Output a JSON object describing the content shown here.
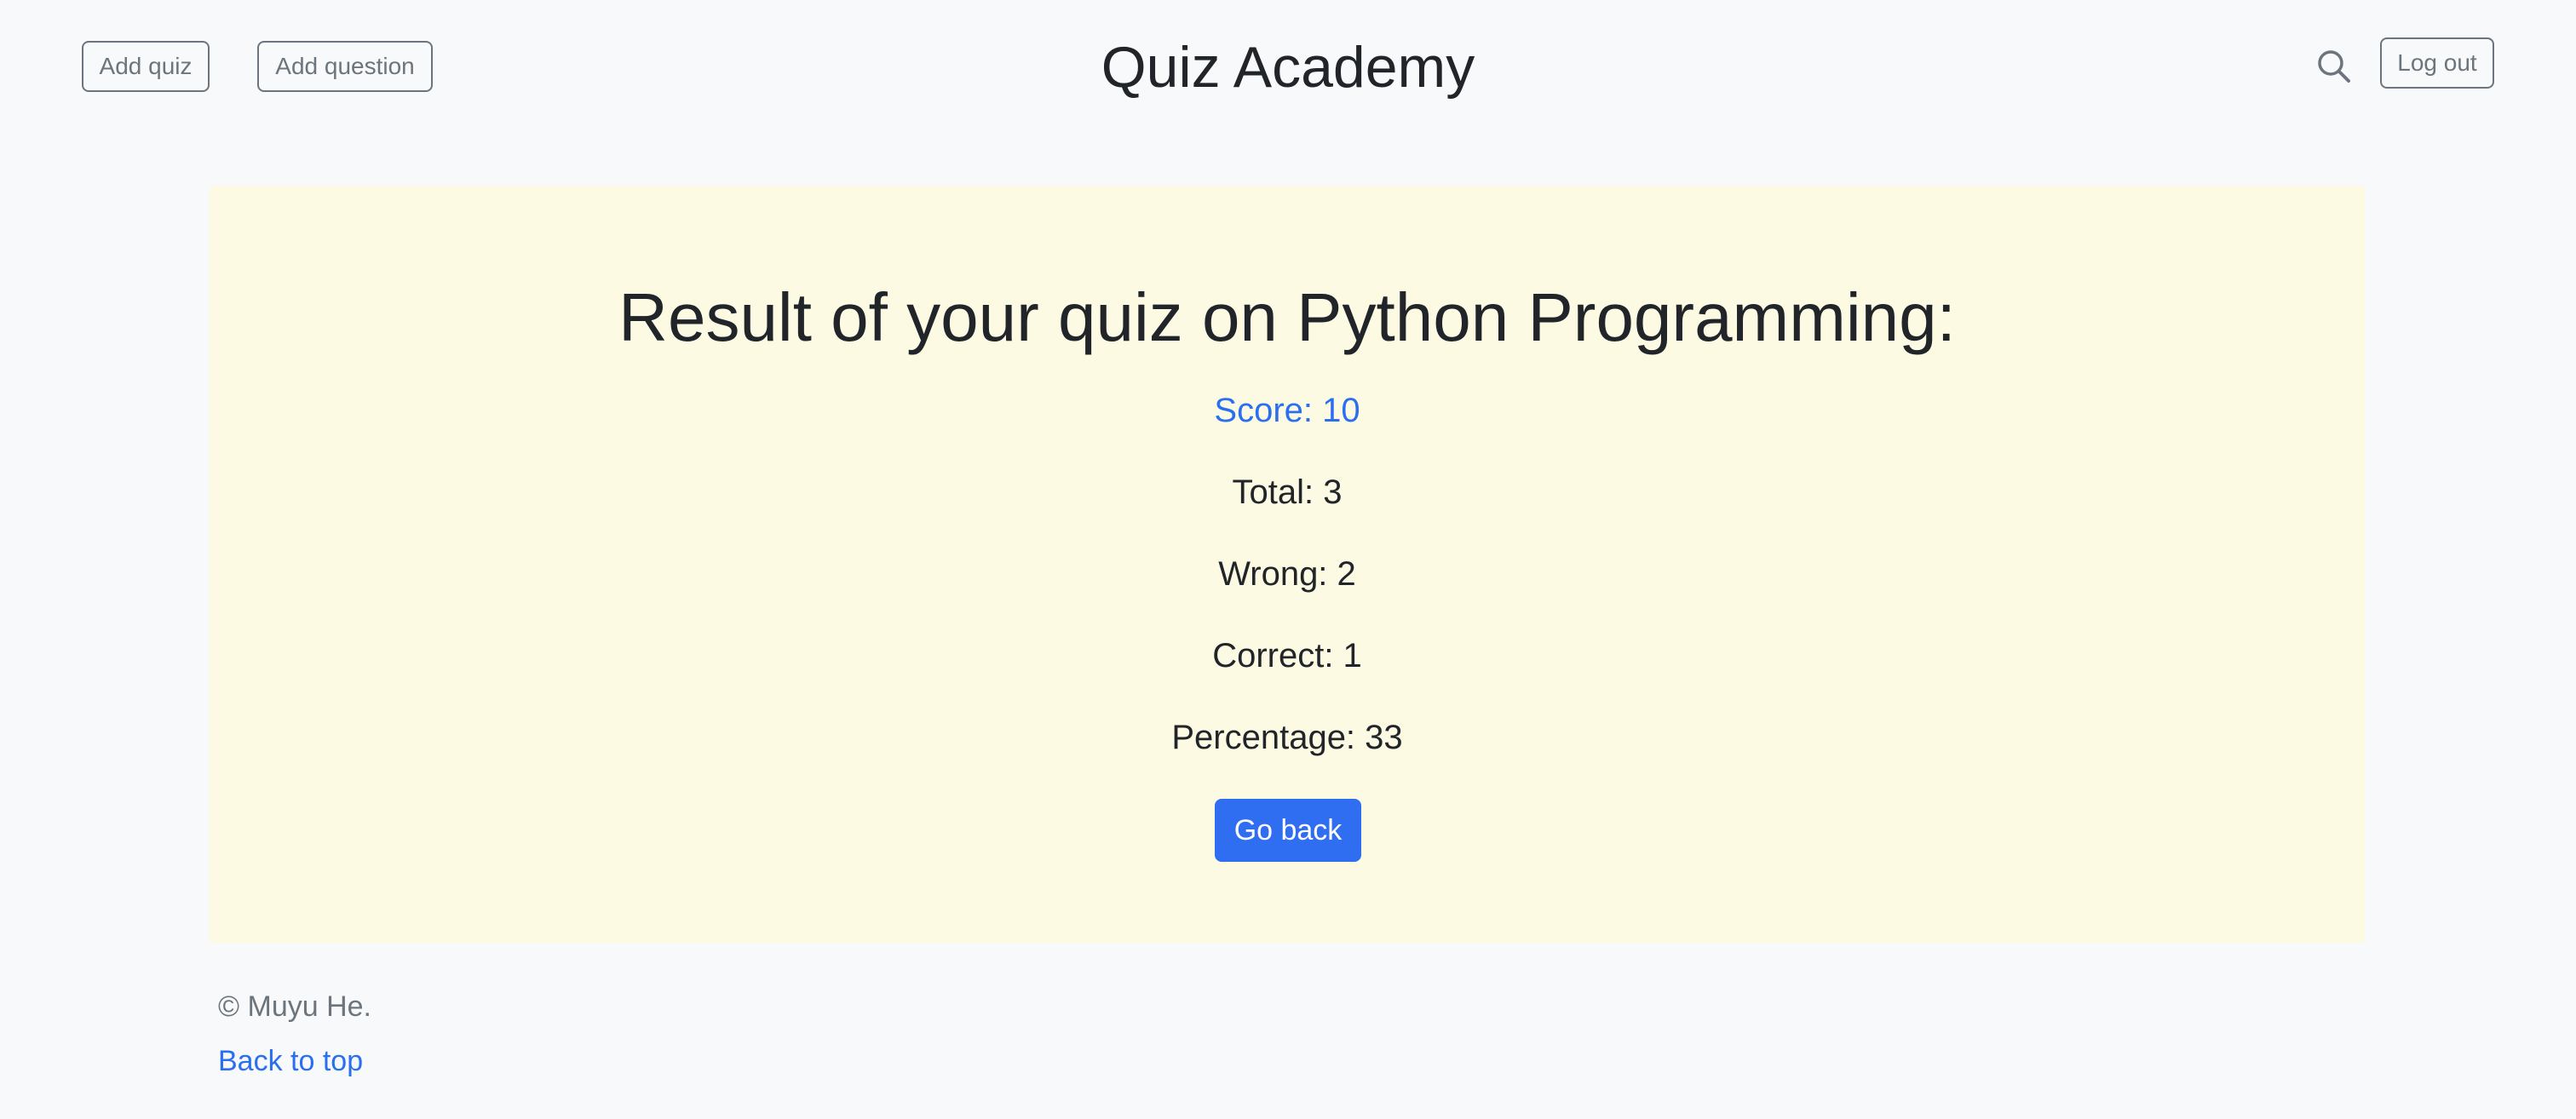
{
  "header": {
    "add_quiz_label": "Add quiz",
    "add_question_label": "Add question",
    "site_title": "Quiz Academy",
    "search_icon": "search-icon",
    "logout_label": "Log out"
  },
  "result": {
    "title": "Result of your quiz on Python Programming:",
    "score": "Score: 10",
    "total": "Total: 3",
    "wrong": "Wrong: 2",
    "correct": "Correct: 1",
    "percentage": "Percentage: 33",
    "go_back_label": "Go back"
  },
  "footer": {
    "copyright": "© Muyu He.",
    "back_to_top": "Back to top"
  },
  "colors": {
    "page_background": "#f8f9fa",
    "card_background": "#fcfae3",
    "accent": "#2a6ff0",
    "button_primary": "#2f6ef0",
    "outline_gray": "#6c757d",
    "text_dark": "#212529"
  }
}
